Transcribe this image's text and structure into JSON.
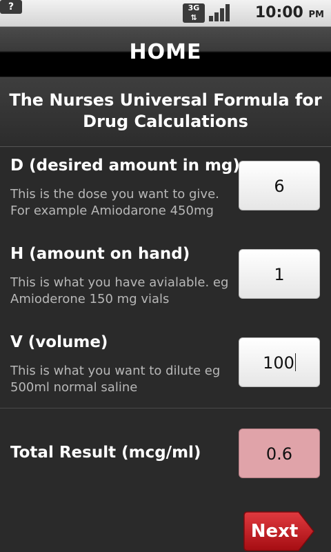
{
  "status_bar": {
    "network": "3G",
    "battery_icon": "battery-unknown-icon",
    "time": "10:00",
    "ampm": "PM"
  },
  "title": "HOME",
  "formula_heading": "The Nurses Universal Formula for Drug Calculations",
  "fields": [
    {
      "label": "D (desired amount in mg)",
      "description": "This is the dose you want to give. For example Amiodarone 450mg",
      "value": "6"
    },
    {
      "label": "H (amount on hand)",
      "description": "This is what you have avialable.  eg Amioderone 150 mg vials",
      "value": "1"
    },
    {
      "label": "V (volume)",
      "description": "This is what you want to dilute eg 500ml  normal saline",
      "value": "100"
    }
  ],
  "result": {
    "label": "Total Result (mcg/ml)",
    "value": "0.6",
    "color": "#e0a3a9"
  },
  "next_button": {
    "label": "Next",
    "color": "#c4161c"
  }
}
